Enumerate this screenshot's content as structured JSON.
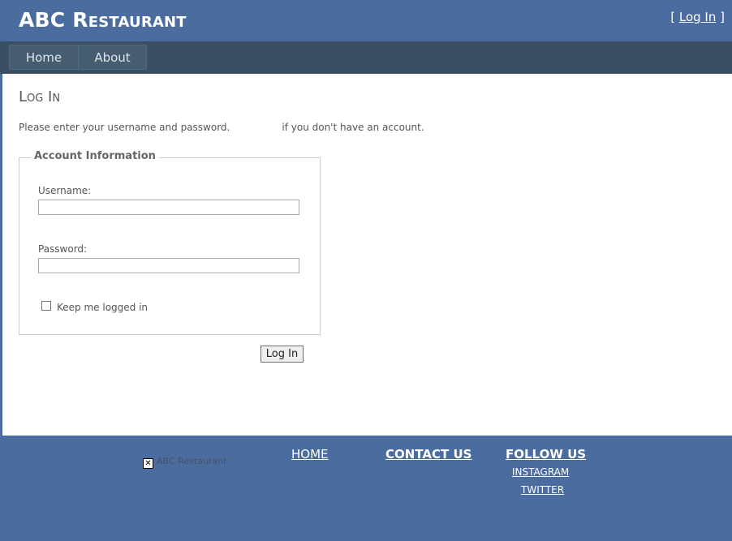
{
  "header": {
    "site_title": "ABC Restaurant",
    "login_bracket_open": "[",
    "login_link": "Log In",
    "login_bracket_close": "]"
  },
  "nav": {
    "items": [
      {
        "label": "Home"
      },
      {
        "label": "About"
      }
    ]
  },
  "main": {
    "heading": "Log In",
    "intro_start": "Please enter your username and password.",
    "intro_end": "if you don't have an account.",
    "fieldset_legend": "Account Information",
    "username_label": "Username:",
    "username_value": "",
    "password_label": "Password:",
    "password_value": "",
    "remember_label": "Keep me logged in",
    "remember_checked": false,
    "submit_label": "Log In"
  },
  "footer": {
    "logo_alt": "ABC Restaurant",
    "links": {
      "home": "HOME",
      "contact": "CONTACT US",
      "follow": "FOLLOW US",
      "instagram": "INSTAGRAM",
      "twitter": "TWITTER"
    }
  },
  "colors": {
    "header_bg": "#4b6c9e",
    "nav_bg": "#3a4f63",
    "footer_bg": "#4b6c9e"
  }
}
